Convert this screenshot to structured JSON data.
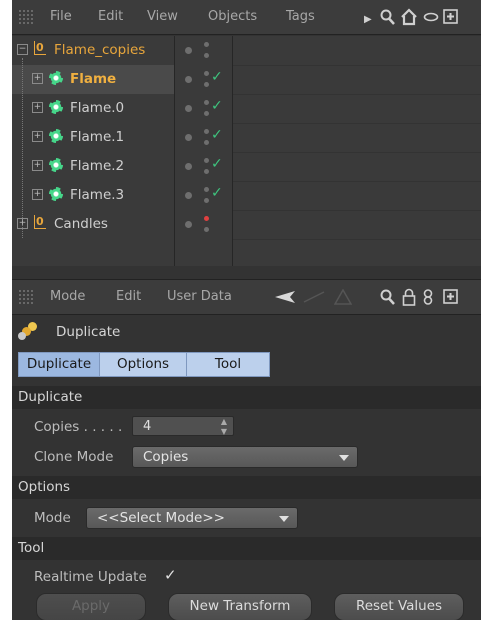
{
  "object_manager": {
    "menu": [
      "File",
      "Edit",
      "View",
      "Objects",
      "Tags"
    ],
    "objects": [
      {
        "name": "Flame_copies",
        "type": "null",
        "color": "orange",
        "check": false,
        "red_dot": false
      },
      {
        "name": "Flame",
        "type": "emitter",
        "color": "orange-bold",
        "check": true,
        "red_dot": false
      },
      {
        "name": "Flame.0",
        "type": "emitter",
        "color": "normal",
        "check": true,
        "red_dot": false
      },
      {
        "name": "Flame.1",
        "type": "emitter",
        "color": "normal",
        "check": true,
        "red_dot": false
      },
      {
        "name": "Flame.2",
        "type": "emitter",
        "color": "normal",
        "check": true,
        "red_dot": false
      },
      {
        "name": "Flame.3",
        "type": "emitter",
        "color": "normal",
        "check": true,
        "red_dot": false
      },
      {
        "name": "Candles",
        "type": "null",
        "color": "normal",
        "check": false,
        "red_dot": true
      }
    ]
  },
  "attribute_manager": {
    "menu": [
      "Mode",
      "Edit",
      "User Data"
    ],
    "title": "Duplicate",
    "tabs": [
      "Duplicate",
      "Options",
      "Tool"
    ],
    "sections": {
      "duplicate": "Duplicate",
      "options": "Options",
      "tool": "Tool"
    },
    "copies_label": "Copies . . . . .",
    "copies_value": "4",
    "clone_mode_label": "Clone Mode",
    "clone_mode_value": "Copies",
    "mode_label": "Mode",
    "mode_value": "<<Select Mode>>",
    "realtime_label": "Realtime Update",
    "realtime_checked": true,
    "buttons": {
      "apply": "Apply",
      "new_transform": "New Transform",
      "reset_values": "Reset Values"
    }
  },
  "colors": {
    "accent_orange": "#e8a63c",
    "check_green": "#3ec47e",
    "tab_blue": "#bcd0ec"
  }
}
